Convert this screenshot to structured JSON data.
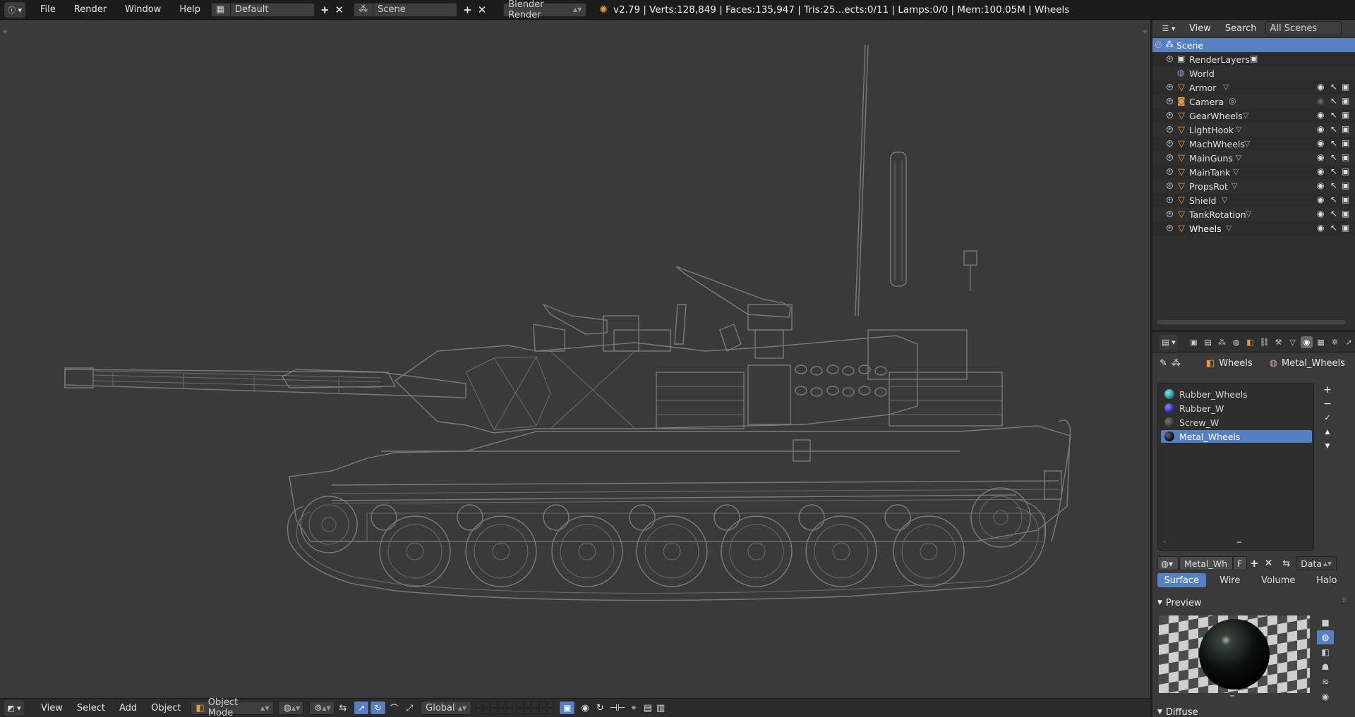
{
  "topbar": {
    "info_icon": "info-icon",
    "menus": [
      "File",
      "Render",
      "Window",
      "Help"
    ],
    "layout_name": "Default",
    "scene_name": "Scene",
    "engine": "Blender Render",
    "stats": "v2.79 | Verts:128,849 | Faces:135,947 | Tris:25...ects:0/11 | Lamps:0/0 | Mem:100.05M | Wheels"
  },
  "viewport": {
    "object": "tank-wireframe",
    "wire_color": "#7a7a7a",
    "background": "#3a3a3a"
  },
  "bottombar": {
    "menus": [
      "View",
      "Select",
      "Add",
      "Object"
    ],
    "mode": "Object Mode",
    "orientation": "Global"
  },
  "outliner": {
    "menus": [
      "View",
      "Search"
    ],
    "scope": "All Scenes",
    "rows": [
      {
        "label": "Scene",
        "type": "scene",
        "selected": true
      },
      {
        "label": "RenderLayers",
        "type": "renderlayers"
      },
      {
        "label": "World",
        "type": "world"
      },
      {
        "label": "Armor",
        "type": "mesh"
      },
      {
        "label": "Camera",
        "type": "camera"
      },
      {
        "label": "GearWheels",
        "type": "mesh"
      },
      {
        "label": "LightHook",
        "type": "mesh"
      },
      {
        "label": "MachWheels",
        "type": "mesh"
      },
      {
        "label": "MainGuns",
        "type": "mesh"
      },
      {
        "label": "MainTank",
        "type": "mesh"
      },
      {
        "label": "PropsRot",
        "type": "mesh"
      },
      {
        "label": "Shield",
        "type": "mesh"
      },
      {
        "label": "TankRotation",
        "type": "mesh"
      },
      {
        "label": "Wheels",
        "type": "mesh"
      }
    ]
  },
  "properties": {
    "breadcrumb_object": "Wheels",
    "breadcrumb_material": "Metal_Wheels",
    "materials": [
      {
        "name": "Rubber_Wheels",
        "color": "#2f8f8a"
      },
      {
        "name": "Rubber_W",
        "color": "#2a2f9a"
      },
      {
        "name": "Screw_W",
        "color": "#3a3a3a"
      },
      {
        "name": "Metal_Wheels",
        "color": "#111111",
        "selected": true
      }
    ],
    "material_field": "Metal_Wh",
    "fake_user": "F",
    "link": "Data",
    "shading_tabs": [
      "Surface",
      "Wire",
      "Volume",
      "Halo"
    ],
    "active_tab": "Surface",
    "panels": {
      "preview": "Preview",
      "diffuse": "Diffuse"
    }
  }
}
